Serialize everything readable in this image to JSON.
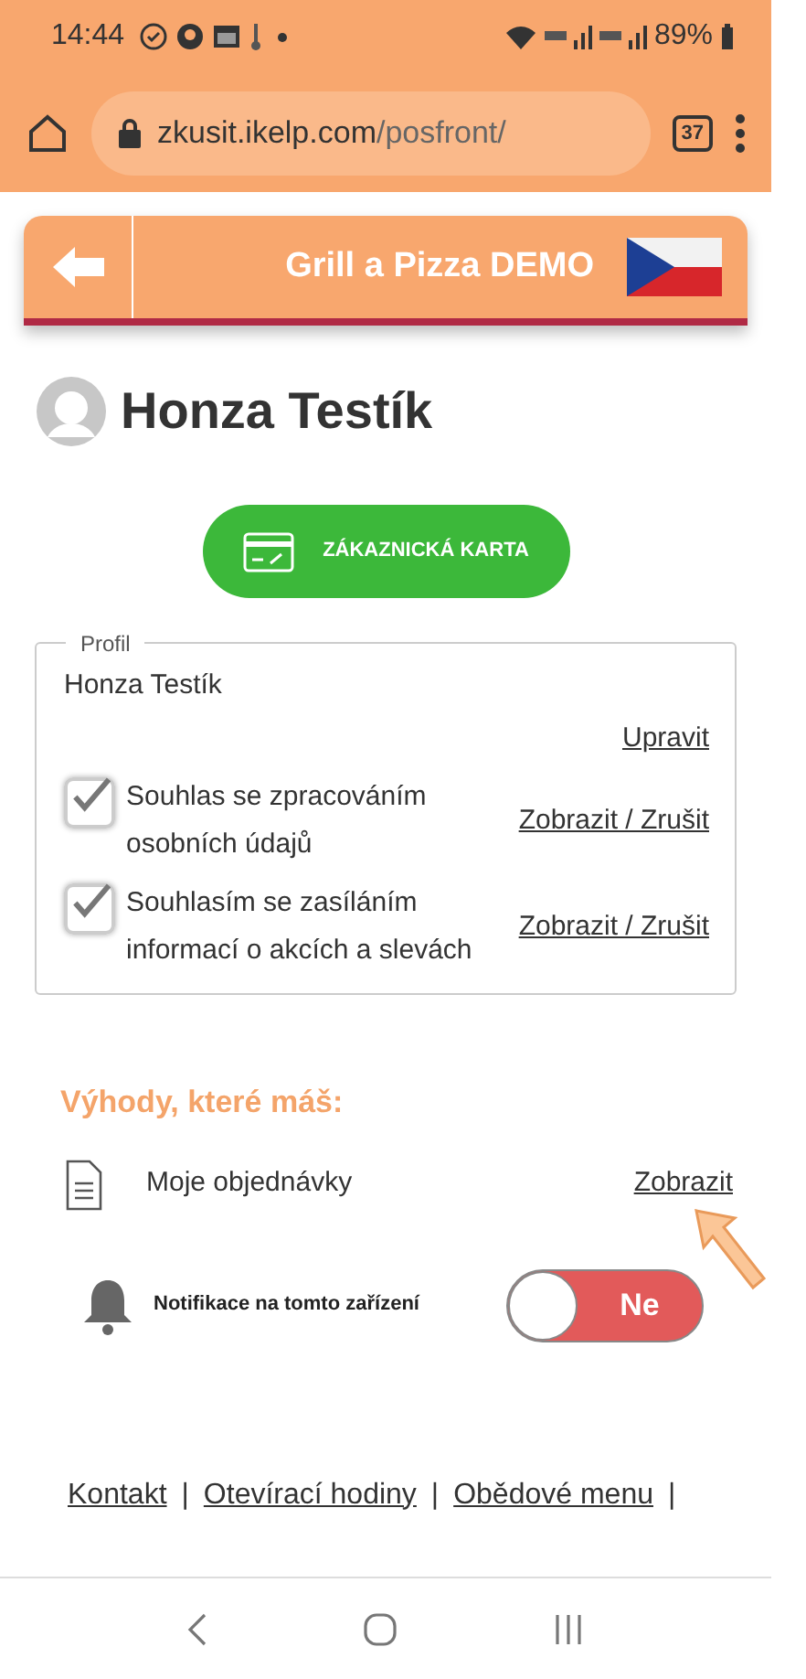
{
  "status_bar": {
    "time": "14:44",
    "battery": "89%"
  },
  "browser": {
    "url_host": "zkusit.ikelp.com",
    "url_path": "/posfront/",
    "tab_count": "37"
  },
  "header": {
    "title": "Grill a Pizza DEMO"
  },
  "profile_heading": "Honza Testík",
  "card_button": "ZÁKAZNICKÁ KARTA",
  "profile_box": {
    "legend": "Profil",
    "name": "Honza Testík",
    "edit_link": "Upravit",
    "consents": [
      {
        "text": "Souhlas se zpracováním osobních údajů",
        "checked": true,
        "link": "Zobrazit / Zrušit"
      },
      {
        "text": "Souhlasím se zasíláním informací o akcích a slevách",
        "checked": true,
        "link": "Zobrazit / Zrušit"
      }
    ]
  },
  "benefits": {
    "title": "Výhody, které máš:",
    "items": [
      {
        "label": "Moje objednávky",
        "link": "Zobrazit"
      }
    ]
  },
  "notification": {
    "label": "Notifikace na tomto zařízení",
    "on": false,
    "toggle_text": "Ne"
  },
  "footer": {
    "links": [
      "Kontakt",
      "Otevírací hodiny",
      "Obědové menu"
    ],
    "separator": "|"
  }
}
